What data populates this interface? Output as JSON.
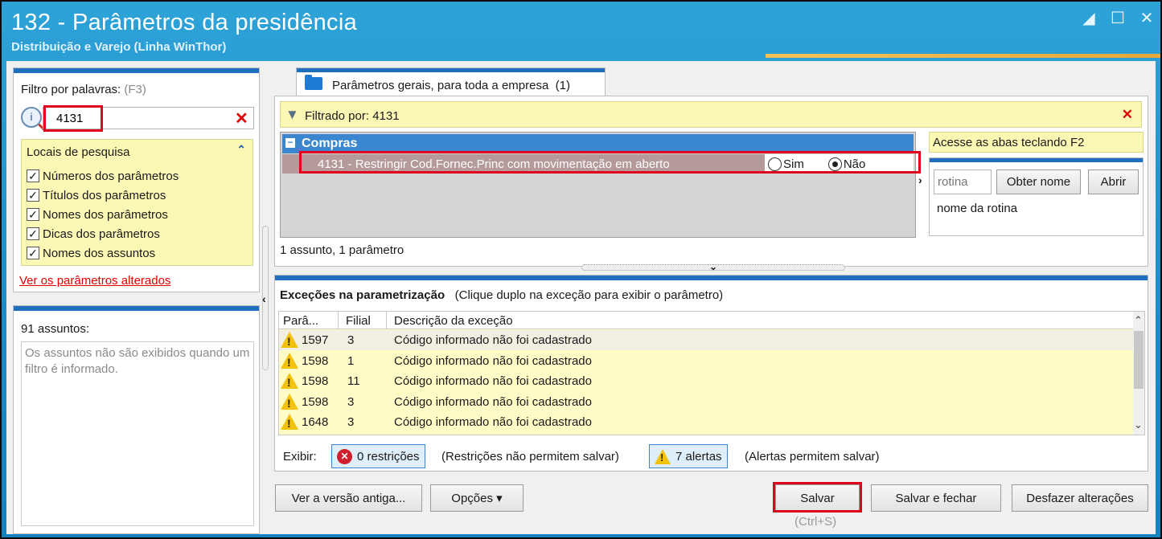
{
  "window": {
    "title": "132 - Parâmetros da presidência",
    "subtitle": "Distribuição e Varejo (Linha WinThor)",
    "controls": [
      "restore-icon",
      "maximize-icon",
      "close-icon"
    ]
  },
  "filter": {
    "label": "Filtro por palavras:",
    "shortcut": "(F3)",
    "value": "4131",
    "locais_title": "Locais de pesquisa",
    "options": [
      {
        "label": "Números dos parâmetros",
        "checked": true
      },
      {
        "label": "Títulos dos parâmetros",
        "checked": true
      },
      {
        "label": "Nomes dos parâmetros",
        "checked": true
      },
      {
        "label": "Dicas dos parâmetros",
        "checked": true
      },
      {
        "label": "Nomes dos assuntos",
        "checked": true
      }
    ],
    "altered_link": "Ver os parâmetros alterados"
  },
  "assuntos": {
    "count": "91 assuntos:",
    "message": "Os assuntos não são exibidos quando um filtro é informado."
  },
  "tab": {
    "label": "Parâmetros gerais, para toda a empresa",
    "count": "(1)"
  },
  "filtered": {
    "text": "Filtrado por: 4131"
  },
  "group": {
    "title": "Compras",
    "toggle": "−"
  },
  "param": {
    "text": "4131 - Restringir Cod.Fornec.Princ com movimentação em aberto",
    "options": [
      {
        "label": "Sim",
        "selected": false
      },
      {
        "label": "Não",
        "selected": true
      }
    ]
  },
  "summary": "1 assunto, 1 parâmetro",
  "help": {
    "text": "Acesse as abas teclando F2"
  },
  "rotina": {
    "placeholder": "rotina",
    "get_name_label": "Obter nome",
    "open_label": "Abrir",
    "name_text": "nome da rotina"
  },
  "exceptions": {
    "title": "Exceções na parametrização",
    "hint": "(Clique duplo na exceção para exibir o parâmetro)",
    "columns": [
      "Parâ...",
      "Filial",
      "Descrição da exceção"
    ],
    "rows": [
      {
        "param": "1597",
        "filial": "3",
        "desc": "Código informado não foi cadastrado"
      },
      {
        "param": "1598",
        "filial": "1",
        "desc": "Código informado não foi cadastrado"
      },
      {
        "param": "1598",
        "filial": "11",
        "desc": "Código informado não foi cadastrado"
      },
      {
        "param": "1598",
        "filial": "3",
        "desc": "Código informado não foi cadastrado"
      },
      {
        "param": "1648",
        "filial": "3",
        "desc": "Código informado não foi cadastrado"
      }
    ],
    "exibir_label": "Exibir:",
    "restricoes_label": "0 restrições",
    "restricoes_note": "(Restrições não permitem salvar)",
    "alertas_label": "7 alertas",
    "alertas_note": "(Alertas permitem salvar)"
  },
  "footer": {
    "old_version_label": "Ver a versão antiga...",
    "options_label": "Opções",
    "save_label": "Salvar",
    "save_close_label": "Salvar e fechar",
    "undo_label": "Desfazer alterações",
    "save_shortcut": "(Ctrl+S)"
  },
  "colors": {
    "title_bar": "#1b8cc7",
    "accent_blue": "#1f6fbf",
    "highlight_yellow": "#fbf8b5",
    "selected_row": "#b49a98",
    "annotation_red": "#e0001b"
  }
}
